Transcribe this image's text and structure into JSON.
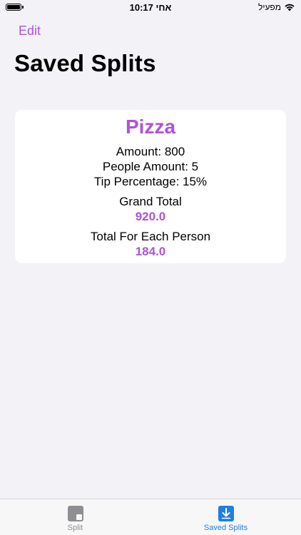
{
  "status_bar": {
    "time": "10:17 אחי",
    "carrier": "מפעיל"
  },
  "nav": {
    "edit_label": "Edit",
    "title": "Saved Splits"
  },
  "split_card": {
    "title": "Pizza",
    "amount": "Amount: 800",
    "people_amount": "People Amount: 5",
    "tip_percentage": "Tip Percentage: 15%",
    "grand_total_label": "Grand Total",
    "grand_total_value": "920.0",
    "each_person_label": "Total For Each Person",
    "each_person_value": "184.0"
  },
  "tab_bar": {
    "tabs": [
      {
        "label": "Split",
        "icon": "split-icon",
        "selected": false
      },
      {
        "label": "Saved Splits",
        "icon": "saved-download-icon",
        "selected": true
      }
    ]
  },
  "colors": {
    "accent": "#af52de",
    "tab_selected": "#1e7fe0",
    "tab_unselected": "#8e8e93",
    "background": "#f2f2f7"
  }
}
